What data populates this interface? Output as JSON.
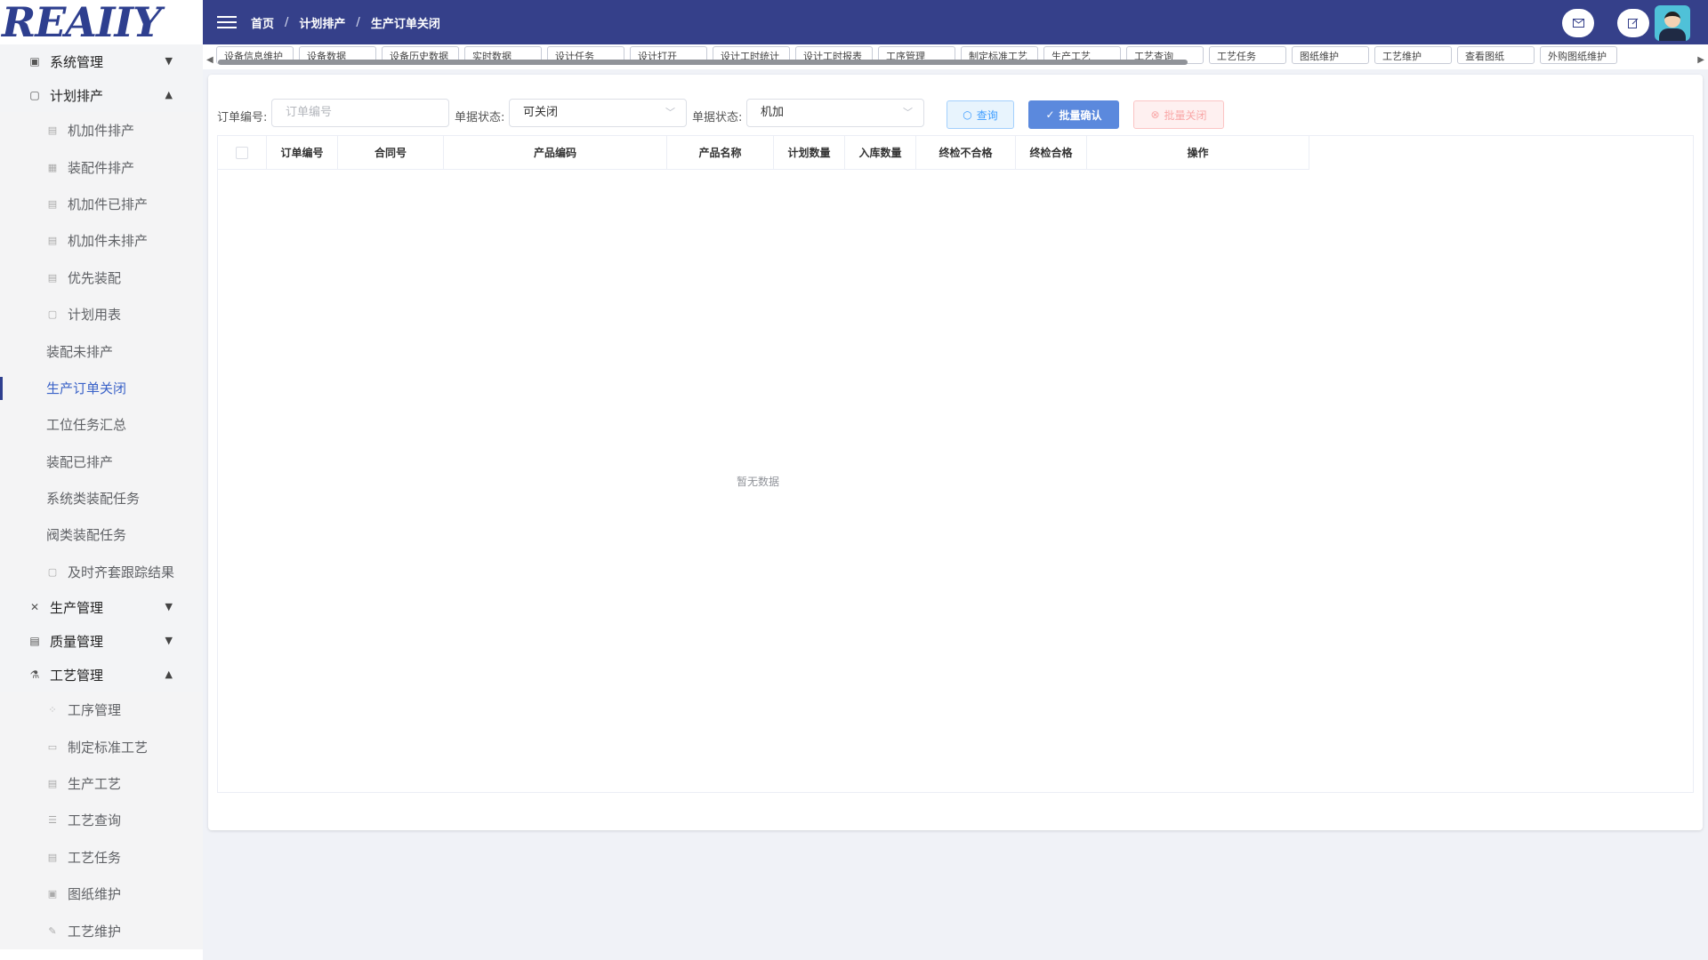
{
  "logo": {
    "text": "REAIIY"
  },
  "header": {
    "breadcrumb": [
      "首页",
      "计划排产",
      "生产订单关闭"
    ],
    "separator": "/",
    "mail_icon": "mail-icon",
    "edit_icon": "edit-icon"
  },
  "sidebar": {
    "groups": [
      {
        "label": "系统管理",
        "icon": "monitor-icon",
        "expanded": false
      },
      {
        "label": "计划排产",
        "icon": "document-icon",
        "expanded": true
      },
      {
        "label": "生产管理",
        "icon": "tools-icon",
        "expanded": false
      },
      {
        "label": "质量管理",
        "icon": "clipboard-icon",
        "expanded": false
      },
      {
        "label": "工艺管理",
        "icon": "flask-icon",
        "expanded": true
      }
    ],
    "plan_items": [
      {
        "label": "机加件排产",
        "icon": "doc-icon"
      },
      {
        "label": "装配件排产",
        "icon": "calendar-icon"
      },
      {
        "label": "机加件已排产",
        "icon": "doc-icon"
      },
      {
        "label": "机加件未排产",
        "icon": "doc-icon"
      },
      {
        "label": "优先装配",
        "icon": "doc-icon"
      },
      {
        "label": "计划用表",
        "icon": "file-icon"
      },
      {
        "label": "装配未排产",
        "icon": ""
      },
      {
        "label": "生产订单关闭",
        "icon": "",
        "active": true
      },
      {
        "label": "工位任务汇总",
        "icon": ""
      },
      {
        "label": "装配已排产",
        "icon": ""
      },
      {
        "label": "系统类装配任务",
        "icon": ""
      },
      {
        "label": "阀类装配任务",
        "icon": ""
      },
      {
        "label": "及时齐套跟踪结果",
        "icon": "file-icon"
      }
    ],
    "craft_items": [
      {
        "label": "工序管理",
        "icon": "grid-icon"
      },
      {
        "label": "制定标准工艺",
        "icon": "card-icon"
      },
      {
        "label": "生产工艺",
        "icon": "doc-icon"
      },
      {
        "label": "工艺查询",
        "icon": "list-icon"
      },
      {
        "label": "工艺任务",
        "icon": "doc-icon"
      },
      {
        "label": "图纸维护",
        "icon": "monitor-icon"
      },
      {
        "label": "工艺维护",
        "icon": "wrench-icon"
      }
    ]
  },
  "tabs": [
    "设备信息维护",
    "设备数据",
    "设备历史数据",
    "实时数据",
    "设计任务",
    "设计打开",
    "设计工时统计",
    "设计工时报表",
    "工序管理",
    "制定标准工艺",
    "生产工艺",
    "工艺查询",
    "工艺任务",
    "图纸维护",
    "工艺维护",
    "查看图纸",
    "外购图纸维护"
  ],
  "filters": {
    "order_no_label": "订单编号:",
    "order_no_placeholder": "订单编号",
    "status_label": "单据状态:",
    "status_value": "可关闭",
    "type_label": "单据状态:",
    "type_value": "机加"
  },
  "buttons": {
    "query": "查询",
    "batch_confirm": "批量确认",
    "batch_close": "批量关闭"
  },
  "table": {
    "columns": [
      "订单编号",
      "合同号",
      "产品编码",
      "产品名称",
      "计划数量",
      "入库数量",
      "终检不合格",
      "终检合格",
      "操作"
    ],
    "empty_text": "暂无数据"
  }
}
